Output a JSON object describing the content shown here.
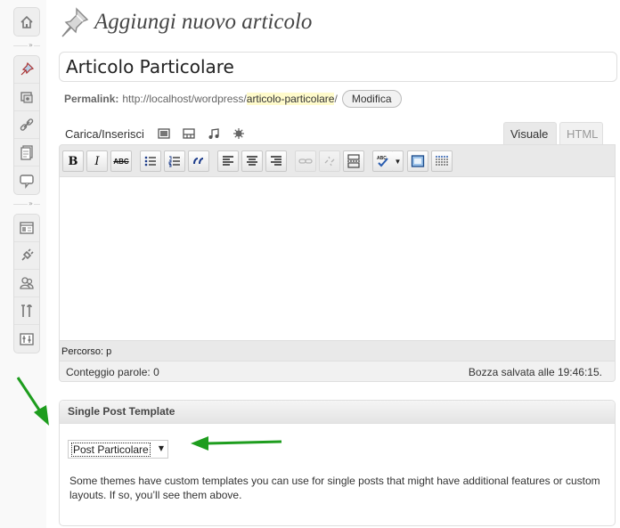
{
  "colors": {
    "annotation_arrow": "#1e9d1e",
    "slug_highlight": "#fffbcc"
  },
  "sidebar": {
    "group1": [
      {
        "icon": "dashboard-icon"
      }
    ],
    "separator_glyph": "»",
    "group2": [
      {
        "icon": "posts-pin-icon"
      },
      {
        "icon": "media-icon"
      },
      {
        "icon": "links-icon"
      },
      {
        "icon": "pages-icon"
      },
      {
        "icon": "comments-icon"
      }
    ],
    "group3": [
      {
        "icon": "appearance-icon"
      },
      {
        "icon": "plugins-icon"
      },
      {
        "icon": "users-icon"
      },
      {
        "icon": "tools-icon"
      },
      {
        "icon": "settings-icon"
      }
    ]
  },
  "header": {
    "title": "Aggiungi nuovo articolo",
    "icon": "pushpin-icon"
  },
  "post": {
    "title_value": "Articolo Particolare"
  },
  "permalink": {
    "label": "Permalink:",
    "base": "http://localhost/wordpress/",
    "slug": "articolo-particolare",
    "trailing": "/",
    "edit_button": "Modifica"
  },
  "media": {
    "label": "Carica/Inserisci",
    "icons": [
      "image-icon",
      "video-icon",
      "audio-icon",
      "media-star-icon"
    ]
  },
  "tabs": {
    "visual": "Visuale",
    "html": "HTML"
  },
  "toolbar": {
    "bold": "B",
    "italic": "I",
    "strikethrough": "ABC",
    "icons": [
      "bold-icon",
      "italic-icon",
      "strikethrough-icon",
      "bullet-list-icon",
      "numbered-list-icon",
      "blockquote-icon",
      "align-left-icon",
      "align-center-icon",
      "align-right-icon",
      "link-icon",
      "unlink-icon",
      "more-tag-icon",
      "spellcheck-icon",
      "fullscreen-icon",
      "kitchen-sink-icon"
    ]
  },
  "editor": {
    "path_label": "Percorso: p",
    "word_count": "Conteggio parole: 0",
    "draft_saved": "Bozza salvata alle 19:46:15."
  },
  "metabox": {
    "title": "Single Post Template",
    "selected_template": "Post Particolare",
    "description": "Some themes have custom templates you can use for single posts that might have additional features or custom layouts. If so, you’ll see them above."
  }
}
